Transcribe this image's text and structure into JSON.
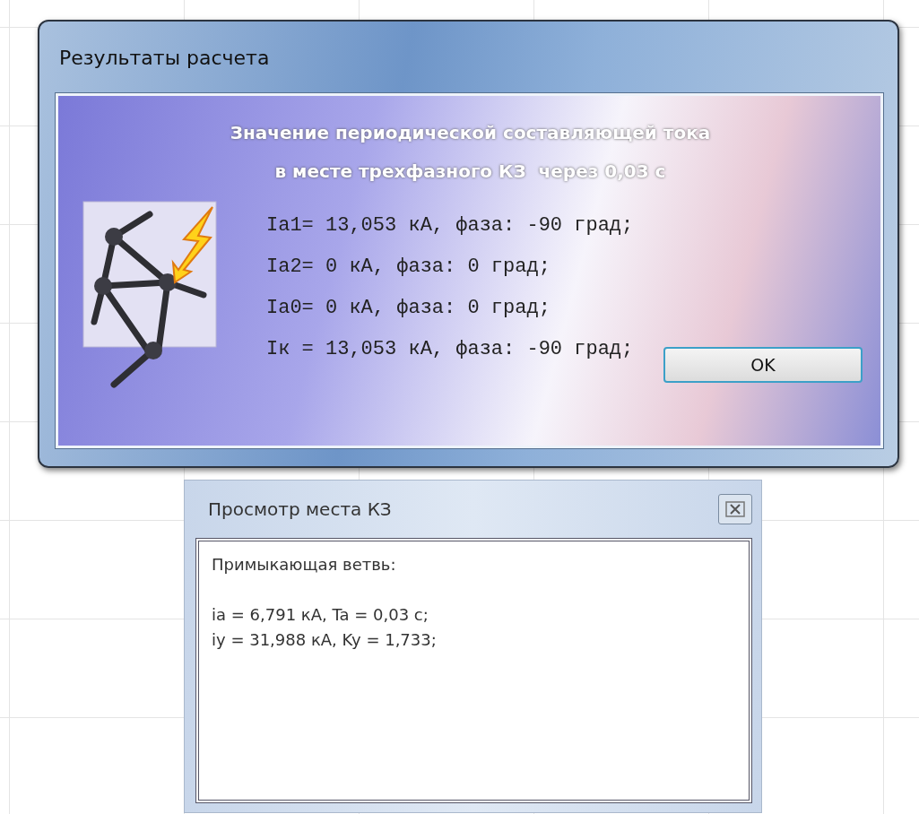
{
  "results_dialog": {
    "title": "Результаты расчета",
    "heading": [
      "Значение периодической составляющей тока",
      "в месте трехфазного КЗ  через 0,03 с"
    ],
    "lines": [
      "Ia1= 13,053 кА, фаза: -90 град;",
      "Ia2= 0 кА, фаза: 0 град;",
      "Ia0= 0 кА, фаза: 0 град;",
      "Iк = 13,053 кА, фаза: -90 град;"
    ],
    "buttons": [
      "OK"
    ]
  },
  "fault_view_window": {
    "title": "Просмотр места КЗ",
    "label": "Примыкающая ветвь:",
    "lines": [
      "ia = 6,791 кА, Ta = 0,03 с;",
      "iy = 31,988 кА, Ky = 1,733;"
    ]
  }
}
